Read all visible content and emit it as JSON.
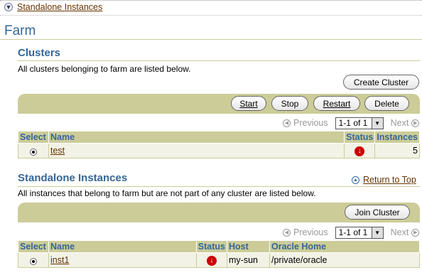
{
  "breadcrumb": {
    "label": "Standalone Instances"
  },
  "page": {
    "title": "Farm"
  },
  "clusters": {
    "title": "Clusters",
    "description": "All clusters belonging to farm are listed below.",
    "create_label": "Create Cluster",
    "actions": {
      "start": "Start",
      "stop": "Stop",
      "restart": "Restart",
      "delete": "Delete"
    },
    "pager": {
      "previous": "Previous",
      "range": "1-1 of 1",
      "next": "Next"
    },
    "columns": {
      "select": "Select",
      "name": "Name",
      "status": "Status",
      "instances": "Instances"
    },
    "rows": [
      {
        "name": "test",
        "status": "down",
        "instances": "5"
      }
    ]
  },
  "standalone": {
    "title": "Standalone Instances",
    "return_label": "Return to Top",
    "description": "All instances that belong to farm but are not part of any cluster are listed below.",
    "join_label": "Join Cluster",
    "pager": {
      "previous": "Previous",
      "range": "1-1 of 1",
      "next": "Next"
    },
    "columns": {
      "select": "Select",
      "name": "Name",
      "status": "Status",
      "host": "Host",
      "oracle_home": "Oracle Home"
    },
    "rows": [
      {
        "name": "inst1",
        "status": "down",
        "host": "my-sun",
        "oracle_home": "/private/oracle"
      }
    ]
  },
  "colors": {
    "header_bg": "#cccc99",
    "title_blue": "#336699",
    "link_brown": "#663300",
    "status_down": "#cc0000"
  }
}
